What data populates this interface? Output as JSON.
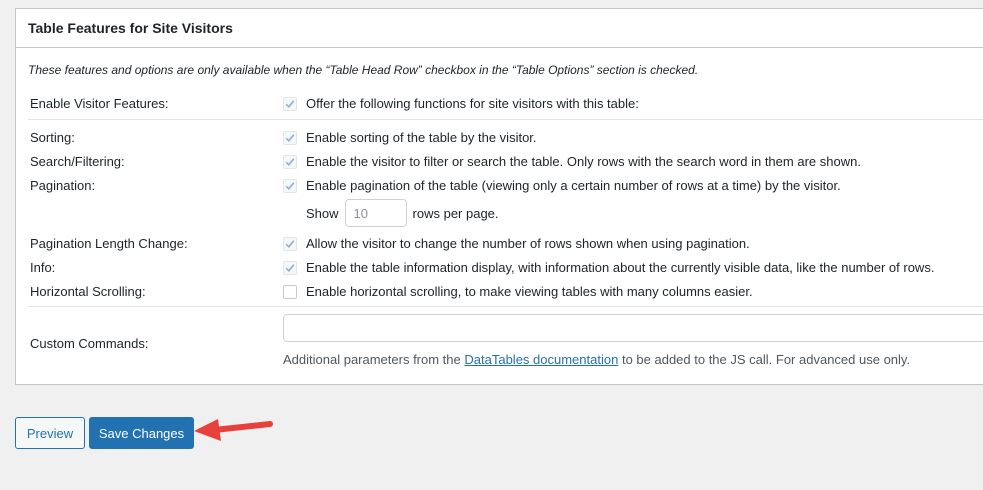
{
  "section": {
    "title": "Table Features for Site Visitors",
    "notice": "These features and options are only available when the “Table Head Row” checkbox in the “Table Options” section is checked."
  },
  "options": [
    {
      "label": "Enable Visitor Features:",
      "text": "Offer the following functions for site visitors with this table:",
      "checked": true
    },
    {
      "label": "Sorting:",
      "text": "Enable sorting of the table by the visitor.",
      "checked": true
    },
    {
      "label": "Search/Filtering:",
      "text": "Enable the visitor to filter or search the table. Only rows with the search word in them are shown.",
      "checked": true
    },
    {
      "label": "Pagination:",
      "text": "Enable pagination of the table (viewing only a certain number of rows at a time) by the visitor.",
      "checked": true
    },
    {
      "label": "Pagination Length Change:",
      "text": "Allow the visitor to change the number of rows shown when using pagination.",
      "checked": true
    },
    {
      "label": "Info:",
      "text": "Enable the table information display, with information about the currently visible data, like the number of rows.",
      "checked": true
    },
    {
      "label": "Horizontal Scrolling:",
      "text": "Enable horizontal scrolling, to make viewing tables with many columns easier.",
      "checked": false
    }
  ],
  "pagination": {
    "show_label": "Show",
    "rows_value": "10",
    "rows_suffix": "rows per page."
  },
  "custom_commands": {
    "label": "Custom Commands:",
    "value": "",
    "desc_before": "Additional parameters from the",
    "link_text": "DataTables documentation",
    "desc_after": "to be added to the JS call. For advanced use only."
  },
  "buttons": {
    "preview": "Preview",
    "save": "Save Changes"
  },
  "colors": {
    "accent": "#2271b1",
    "arrow": "#e8413c",
    "check": "#8fb3d6"
  },
  "icons": {
    "checkbox": "checkmark-icon",
    "annotation": "red-arrow-icon"
  }
}
